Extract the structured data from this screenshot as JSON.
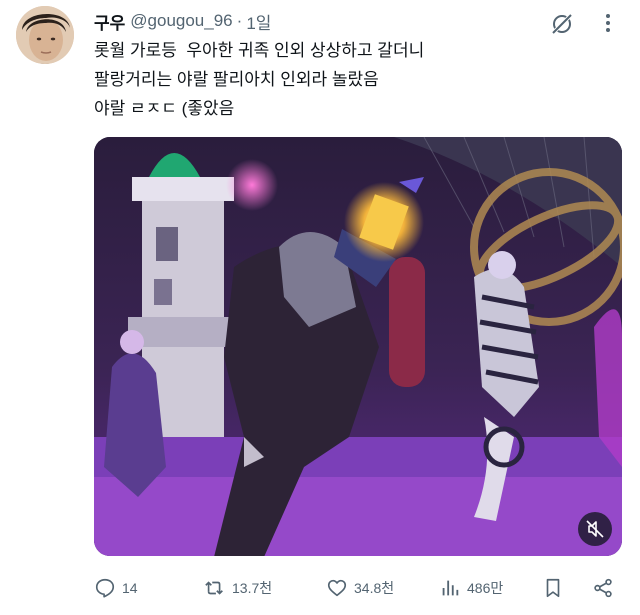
{
  "tweet": {
    "author_name": "구우",
    "handle": "@gougou_96",
    "separator": "·",
    "time": "1일",
    "lines": [
      "롯월 가로등  우아한 귀족 인외 상상하고 갈더니",
      "팔랑거리는 야랄 팔리아치 인외라 놀랐음",
      "야랄 ㄹㅈㄷ (좋았음"
    ]
  },
  "actions": {
    "reply_count": "14",
    "retweet_count": "13.7천",
    "like_count": "34.8천",
    "view_count": "486만"
  },
  "icons": {
    "avatar": "profile-photo",
    "grok": "grok-icon",
    "more": "more-icon",
    "mute": "muted-speaker-icon",
    "reply": "reply-icon",
    "retweet": "retweet-icon",
    "like": "heart-icon",
    "views": "views-icon",
    "bookmark": "bookmark-icon",
    "share": "share-icon"
  },
  "colors": {
    "text": "#0f1419",
    "secondary": "#536471"
  }
}
